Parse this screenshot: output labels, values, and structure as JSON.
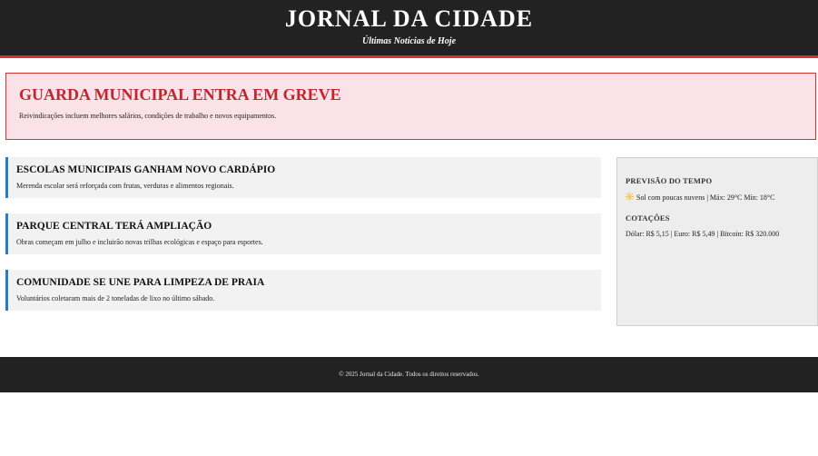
{
  "header": {
    "title": "JORNAL DA CIDADE",
    "subtitle": "Últimas Notícias de Hoje"
  },
  "breaking": {
    "headline": "GUARDA MUNICIPAL ENTRA EM GREVE",
    "summary": "Reivindicações incluem melhores salários, condições de trabalho e novos equipamentos."
  },
  "articles": [
    {
      "title": "ESCOLAS MUNICIPAIS GANHAM NOVO CARDÁPIO",
      "text": "Merenda escolar será reforçada com frutas, verduras e alimentos regionais."
    },
    {
      "title": "PARQUE CENTRAL TERÁ AMPLIAÇÃO",
      "text": "Obras começam em julho e incluirão novas trilhas ecológicas e espaço para esportes."
    },
    {
      "title": "COMUNIDADE SE UNE PARA LIMPEZA DE PRAIA",
      "text": "Voluntários coletaram mais de 2 toneladas de lixo no último sábado."
    }
  ],
  "sidebar": {
    "weather_heading": "PREVISÃO DO TEMPO",
    "weather_icon": "sun-icon",
    "weather_text": "Sol com poucas nuvens | Máx: 29°C Mín: 18°C",
    "quotes_heading": "COTAÇÕES",
    "quotes_text": "Dólar: R$ 5,15 | Euro: R$ 5,49 | Bitcoin: R$ 320.000"
  },
  "footer": {
    "copyright": "© 2025 Jornal da Cidade. Todos os direitos reservados."
  },
  "colors": {
    "header_bg": "#222222",
    "accent_red": "#d0342c",
    "breaking_bg": "#fbe1e8",
    "article_accent_blue": "#2a7cc7",
    "card_bg": "#f2f2f2",
    "sidebar_bg": "#ededed"
  }
}
